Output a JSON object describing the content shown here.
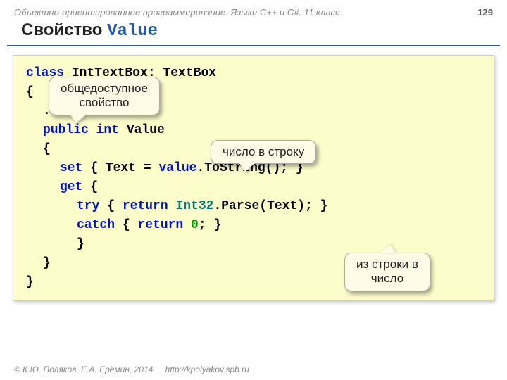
{
  "header": {
    "course": "Объектно-ориентированное программирование. Языки C++ и C#. 11 класс",
    "page": "129"
  },
  "title": {
    "word1": "Свойство",
    "word2": "Value"
  },
  "code": {
    "l1_kw": "class",
    "l1_rest": " IntTextBox: TextBox",
    "l2": "{",
    "l3": "...",
    "l4_kw1": "public",
    "l4_kw2": " int",
    "l4_rest": " Value",
    "l5": "{",
    "l6_kw": "set",
    "l6_a": " { Text = ",
    "l6_val": "value",
    "l6_b": ".ToString(); }",
    "l7_kw": "get",
    "l7_a": " {",
    "l8_kw1": "try",
    "l8_a": " { ",
    "l8_kw2": "return",
    "l8_b": " ",
    "l8_int32": "Int32",
    "l8_c": ".Parse(Text); }",
    "l9_kw1": "catch",
    "l9_a": " { ",
    "l9_kw2": "return",
    "l9_b": " ",
    "l9_zero": "0",
    "l9_c": "; }",
    "l10": "}",
    "l11": "}",
    "l12": "}"
  },
  "callouts": {
    "c1_l1": "общедоступное",
    "c1_l2": "свойство",
    "c2": "число в строку",
    "c3_l1": "из строки в",
    "c3_l2": "число"
  },
  "footer": {
    "copy": "© К.Ю. Поляков, Е.А. Ерёмин, 2014",
    "url": "http://kpolyakov.spb.ru"
  }
}
